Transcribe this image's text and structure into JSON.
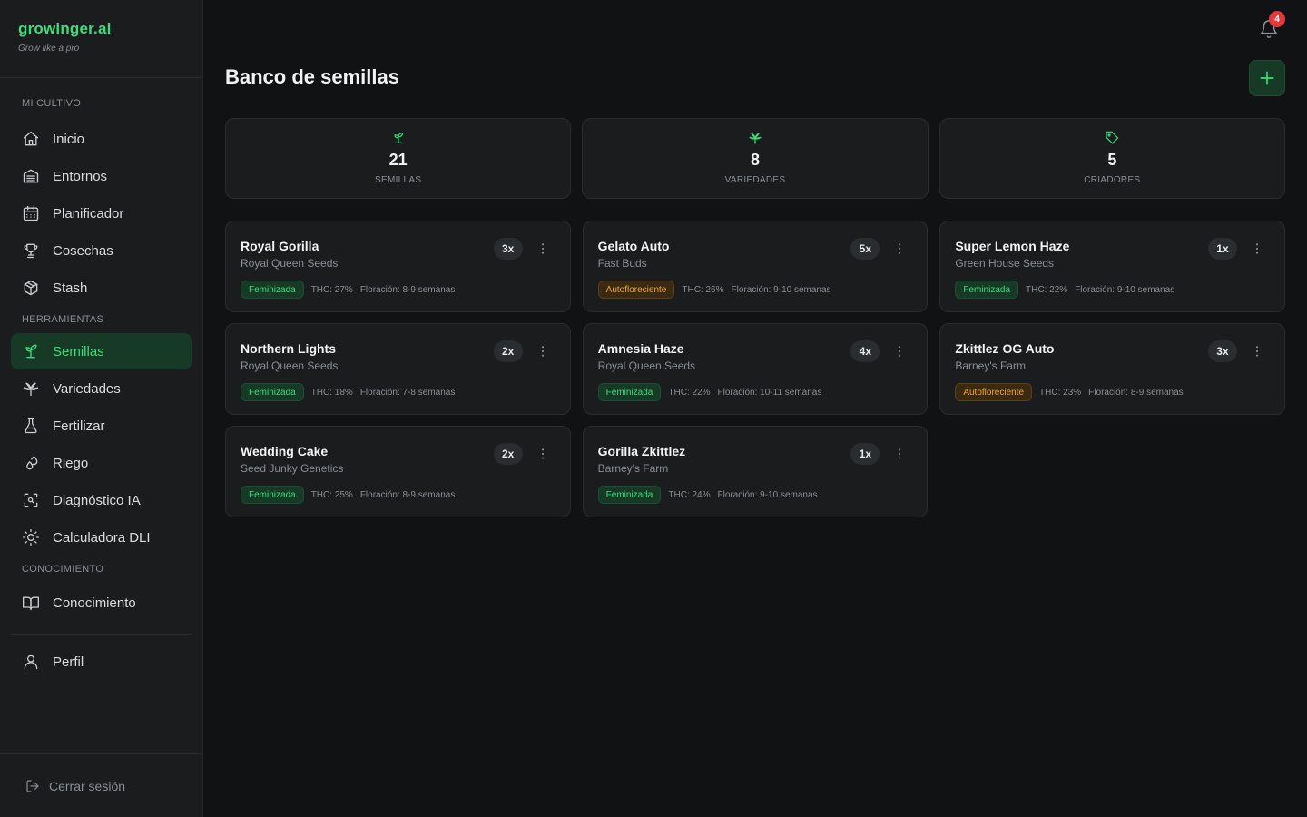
{
  "brand": {
    "name": "growinger.ai",
    "tagline": "Grow like a pro"
  },
  "sidebar": {
    "sections": [
      {
        "label": "MI CULTIVO"
      },
      {
        "label": "HERRAMIENTAS"
      },
      {
        "label": "CONOCIMIENTO"
      }
    ],
    "items": [
      {
        "label": "Inicio",
        "icon": "home-icon"
      },
      {
        "label": "Entornos",
        "icon": "tent-icon"
      },
      {
        "label": "Planificador",
        "icon": "calendar-icon"
      },
      {
        "label": "Cosechas",
        "icon": "trophy-icon"
      },
      {
        "label": "Stash",
        "icon": "box-icon"
      },
      {
        "label": "Semillas",
        "icon": "sprout-icon",
        "active": true
      },
      {
        "label": "Variedades",
        "icon": "leaf-icon"
      },
      {
        "label": "Fertilizar",
        "icon": "flask-icon"
      },
      {
        "label": "Riego",
        "icon": "droplets-icon"
      },
      {
        "label": "Diagnóstico IA",
        "icon": "scan-icon"
      },
      {
        "label": "Calculadora DLI",
        "icon": "sun-icon"
      },
      {
        "label": "Conocimiento",
        "icon": "book-icon"
      },
      {
        "label": "Perfil",
        "icon": "user-icon"
      }
    ],
    "logout_label": "Cerrar sesión"
  },
  "header": {
    "notifications_count": "4"
  },
  "page": {
    "title": "Banco de semillas"
  },
  "stats": [
    {
      "value": "21",
      "label": "SEMILLAS",
      "icon": "sprout-icon"
    },
    {
      "value": "8",
      "label": "VARIEDADES",
      "icon": "leaf-icon"
    },
    {
      "value": "5",
      "label": "CRIADORES",
      "icon": "tag-icon"
    }
  ],
  "seeds": [
    {
      "name": "Royal Gorilla",
      "breeder": "Royal Queen Seeds",
      "qty": "3x",
      "type": "Feminizada",
      "thc": "THC: 27%",
      "flowering": "Floración: 8-9 semanas"
    },
    {
      "name": "Gelato Auto",
      "breeder": "Fast Buds",
      "qty": "5x",
      "type": "Autofloreciente",
      "thc": "THC: 26%",
      "flowering": "Floración: 9-10 semanas"
    },
    {
      "name": "Super Lemon Haze",
      "breeder": "Green House Seeds",
      "qty": "1x",
      "type": "Feminizada",
      "thc": "THC: 22%",
      "flowering": "Floración: 9-10 semanas"
    },
    {
      "name": "Northern Lights",
      "breeder": "Royal Queen Seeds",
      "qty": "2x",
      "type": "Feminizada",
      "thc": "THC: 18%",
      "flowering": "Floración: 7-8 semanas"
    },
    {
      "name": "Amnesia Haze",
      "breeder": "Royal Queen Seeds",
      "qty": "4x",
      "type": "Feminizada",
      "thc": "THC: 22%",
      "flowering": "Floración: 10-11 semanas"
    },
    {
      "name": "Zkittlez OG Auto",
      "breeder": "Barney's Farm",
      "qty": "3x",
      "type": "Autofloreciente",
      "thc": "THC: 23%",
      "flowering": "Floración: 8-9 semanas"
    },
    {
      "name": "Wedding Cake",
      "breeder": "Seed Junky Genetics",
      "qty": "2x",
      "type": "Feminizada",
      "thc": "THC: 25%",
      "flowering": "Floración: 8-9 semanas"
    },
    {
      "name": "Gorilla Zkittlez",
      "breeder": "Barney's Farm",
      "qty": "1x",
      "type": "Feminizada",
      "thc": "THC: 24%",
      "flowering": "Floración: 9-10 semanas"
    }
  ],
  "colors": {
    "accent": "#3ddc7a",
    "auto": "#f0a534",
    "badge": "#e5383b"
  }
}
